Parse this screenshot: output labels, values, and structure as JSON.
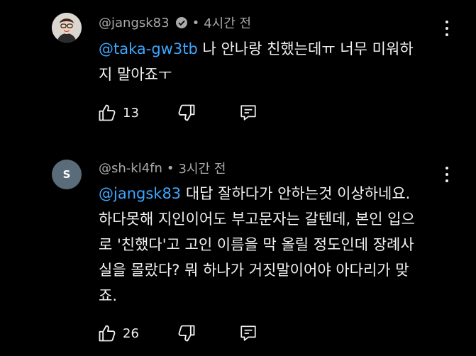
{
  "comments": [
    {
      "author": "@jangsk83",
      "verified": true,
      "time": "4시간 전",
      "mention": "@taka-gw3tb",
      "text_line1": " 나 안나랑 친했는데ㅠ 너무 미워하",
      "text_line2": "지 말아죠ㅜ",
      "likes": "13",
      "avatar_icon": "profile-photo"
    },
    {
      "author": "@sh-kl4fn",
      "avatar_letter": "S",
      "time": "3시간 전",
      "mention": "@jangsk83",
      "text_line1": " 대답 잘하다가 안하는것 이상하네요.",
      "text_line2": "하다못해 지인이어도 부고문자는 갈텐데, 본인 입으",
      "text_line3": "로 '친했다'고 고인 이름을 막 올릴 정도인데 장례사",
      "text_line4": "실을 몰랐다? 뭐 하나가 거짓말이어야 아다리가 맞",
      "text_line5": "죠.",
      "likes": "26"
    }
  ],
  "colors": {
    "background": "#000000",
    "text": "#f1f1f1",
    "meta": "#aaaaaa",
    "mention": "#3ea6ff",
    "avatar_letter_bg": "#5a6b7a"
  }
}
